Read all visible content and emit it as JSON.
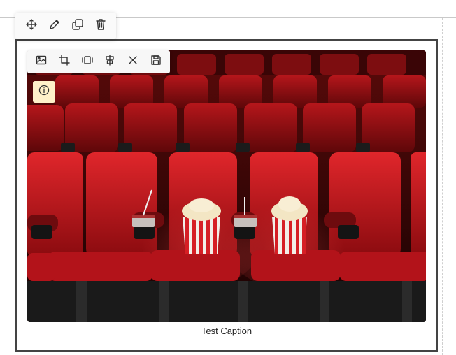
{
  "block_toolbar": {
    "icons": [
      "move-icon",
      "edit-icon",
      "duplicate-icon",
      "trash-icon"
    ]
  },
  "image_toolbar": {
    "icons": [
      "replace-image-icon",
      "crop-icon",
      "resize-icon",
      "align-icon",
      "close-icon",
      "save-icon"
    ]
  },
  "info_button": {
    "icon": "info-icon",
    "color": "#fff1c9"
  },
  "image": {
    "subject": ""
  },
  "caption": "Test Caption",
  "colors": {
    "seat": "#c4141a",
    "frame": "#444444",
    "info_bg": "#fff1c9"
  }
}
